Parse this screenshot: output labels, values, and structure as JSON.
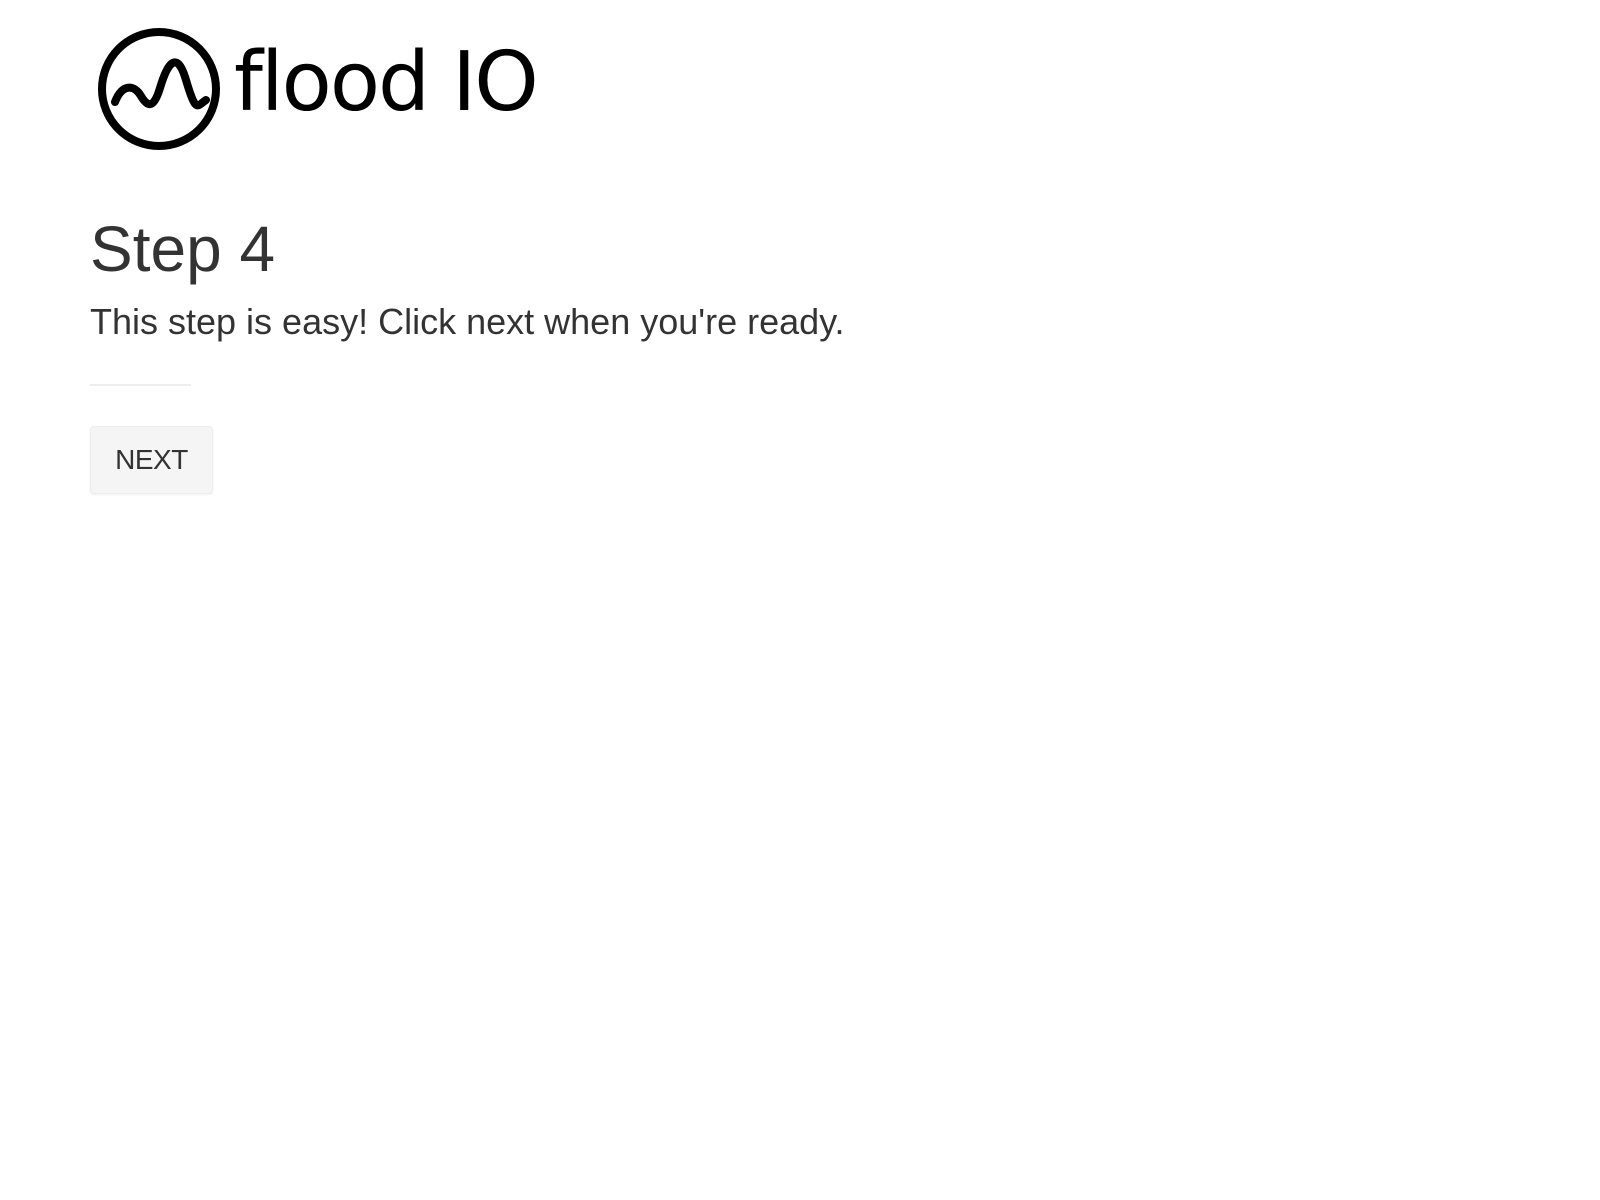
{
  "brand": {
    "logo_icon": "flood-io-wave-circle-icon",
    "name": "flood IO",
    "color": "#000000"
  },
  "step": {
    "title": "Step 4",
    "instruction": "This step is easy! Click next when you're ready."
  },
  "actions": {
    "next_label": "NEXT"
  },
  "colors": {
    "text": "#333333",
    "button_background": "#f5f5f5",
    "divider": "#eeeeee"
  }
}
